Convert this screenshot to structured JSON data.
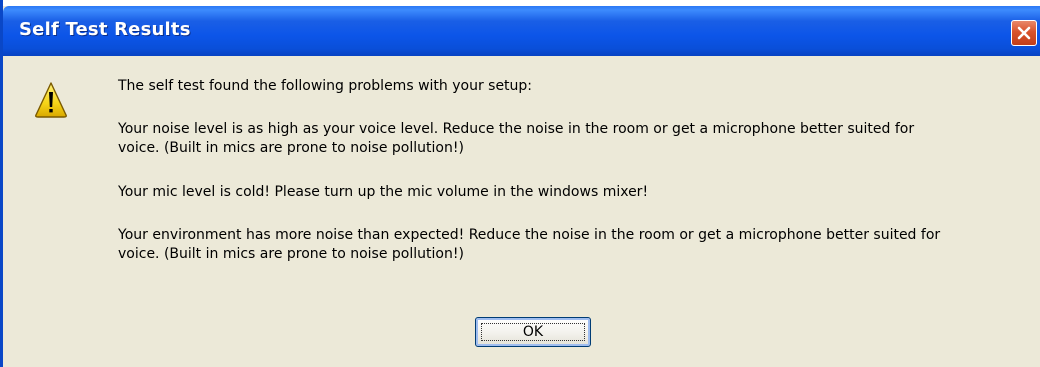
{
  "window": {
    "title": "Self Test Results"
  },
  "icons": {
    "warning": "warning-icon",
    "close": "close-icon"
  },
  "colors": {
    "titlebar": "#0c55e8",
    "background": "#ece9d8",
    "close_button": "#d9532c",
    "warning_fill": "#f6d417"
  },
  "message": {
    "intro": "The self test found the following problems with your setup:",
    "problem1_line1": "Your noise level is as high as your voice level. Reduce the noise in the room or get a microphone better suited for",
    "problem1_line2": "voice. (Built in mics are prone to noise pollution!)",
    "problem2": "Your mic level is cold! Please turn up the mic volume in the windows mixer!",
    "problem3_line1": "Your environment has more noise than expected! Reduce the noise in the room or get a microphone better suited for",
    "problem3_line2": "voice. (Built in mics are prone to noise pollution!)"
  },
  "buttons": {
    "ok_label": "OK"
  }
}
